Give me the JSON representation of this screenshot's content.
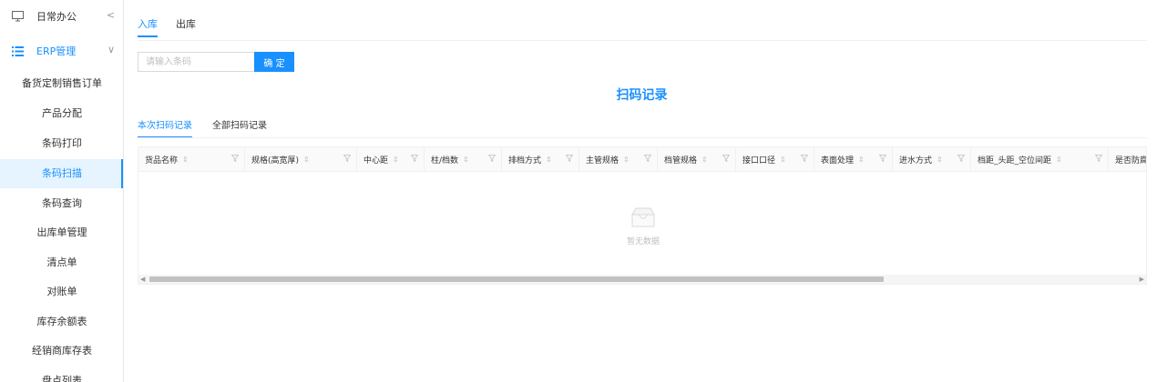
{
  "sidebar": {
    "group_office": {
      "label": "日常办公",
      "icon": "monitor-icon",
      "chevron": "<"
    },
    "group_erp": {
      "label": "ERP管理",
      "icon": "list-icon",
      "chevron": "∨"
    },
    "items": [
      {
        "label": "备货定制销售订单"
      },
      {
        "label": "产品分配"
      },
      {
        "label": "条码打印"
      },
      {
        "label": "条码扫描"
      },
      {
        "label": "条码查询"
      },
      {
        "label": "出库单管理"
      },
      {
        "label": "清点单"
      },
      {
        "label": "对账单"
      },
      {
        "label": "库存余额表"
      },
      {
        "label": "经销商库存表"
      },
      {
        "label": "盘点列表"
      }
    ],
    "active_index": 3,
    "accent_color": "#1890ff"
  },
  "top_tabs": [
    {
      "label": "入库"
    },
    {
      "label": "出库"
    }
  ],
  "search": {
    "placeholder": "请输入条码",
    "value": "",
    "confirm_label": "确 定"
  },
  "records_title": "扫码记录",
  "sub_tabs": [
    {
      "label": "本次扫码记录"
    },
    {
      "label": "全部扫码记录"
    }
  ],
  "table": {
    "columns": [
      "货品名称",
      "规格(高宽厚)",
      "中心距",
      "柱/档数",
      "排档方式",
      "主管规格",
      "档管规格",
      "接口口径",
      "表面处理",
      "进水方式",
      "档距_头距_空位间距",
      "是否防腐"
    ],
    "empty_text": "暂无数据",
    "rows": []
  }
}
